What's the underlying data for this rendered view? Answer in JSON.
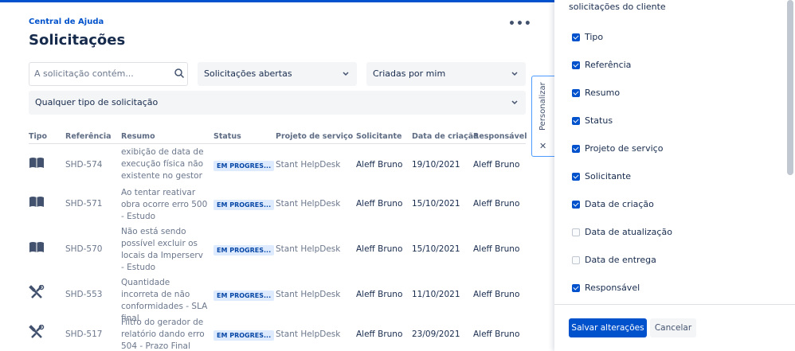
{
  "header": {
    "breadcrumb": "Central de Ajuda",
    "title": "Solicitações",
    "more_label": "•••"
  },
  "filters": {
    "search_placeholder": "A solicitação contém...",
    "status_filter": "Solicitações abertas",
    "creator_filter": "Criadas por mim",
    "type_filter": "Qualquer tipo de solicitação"
  },
  "personalize": {
    "label": "Personalizar",
    "close": "✕"
  },
  "table": {
    "columns": [
      "Tipo",
      "Referência",
      "Resumo",
      "Status",
      "Projeto de serviço",
      "Solicitante",
      "Data de criação",
      "Responsável"
    ],
    "rows": [
      {
        "type_icon": "book-icon",
        "ref": "SHD-574",
        "summary": "exibição de data de execução física não existente no gestor",
        "status": "EM PROGRES...",
        "project": "Stant HelpDesk",
        "requester": "Aleff Bruno",
        "created": "19/10/2021",
        "assignee": "Aleff Bruno"
      },
      {
        "type_icon": "book-icon",
        "ref": "SHD-571",
        "summary": "Ao tentar reativar obra ocorre erro 500 - Estudo",
        "status": "EM PROGRES...",
        "project": "Stant HelpDesk",
        "requester": "Aleff Bruno",
        "created": "15/10/2021",
        "assignee": "Aleff Bruno"
      },
      {
        "type_icon": "book-icon",
        "ref": "SHD-570",
        "summary": "Não está sendo possível excluir os locais da Imperserv - Estudo",
        "status": "EM PROGRES...",
        "project": "Stant HelpDesk",
        "requester": "Aleff Bruno",
        "created": "15/10/2021",
        "assignee": "Aleff Bruno"
      },
      {
        "type_icon": "tools-icon",
        "ref": "SHD-553",
        "summary": "Quantidade incorreta de não conformidades - SLA final",
        "status": "EM PROGRES...",
        "project": "Stant HelpDesk",
        "requester": "Aleff Bruno",
        "created": "11/10/2021",
        "assignee": "Aleff Bruno"
      },
      {
        "type_icon": "tools-icon",
        "ref": "SHD-517",
        "summary": "Filtro do gerador de relatório dando erro 504 - Prazo Final",
        "status": "EM PROGRES...",
        "project": "Stant HelpDesk",
        "requester": "Aleff Bruno",
        "created": "23/09/2021",
        "assignee": "Aleff Bruno"
      }
    ]
  },
  "panel": {
    "heading": "solicitações do cliente",
    "options": [
      {
        "label": "Tipo",
        "checked": true
      },
      {
        "label": "Referência",
        "checked": true
      },
      {
        "label": "Resumo",
        "checked": true
      },
      {
        "label": "Status",
        "checked": true
      },
      {
        "label": "Projeto de serviço",
        "checked": true
      },
      {
        "label": "Solicitante",
        "checked": true
      },
      {
        "label": "Data de criação",
        "checked": true
      },
      {
        "label": "Data de atualização",
        "checked": false
      },
      {
        "label": "Data de entrega",
        "checked": false
      },
      {
        "label": "Responsável",
        "checked": true
      }
    ],
    "save_label": "Salvar alterações",
    "cancel_label": "Cancelar"
  },
  "colors": {
    "accent": "#0052cc",
    "badge_bg": "#deebff",
    "badge_text": "#0747a6"
  }
}
